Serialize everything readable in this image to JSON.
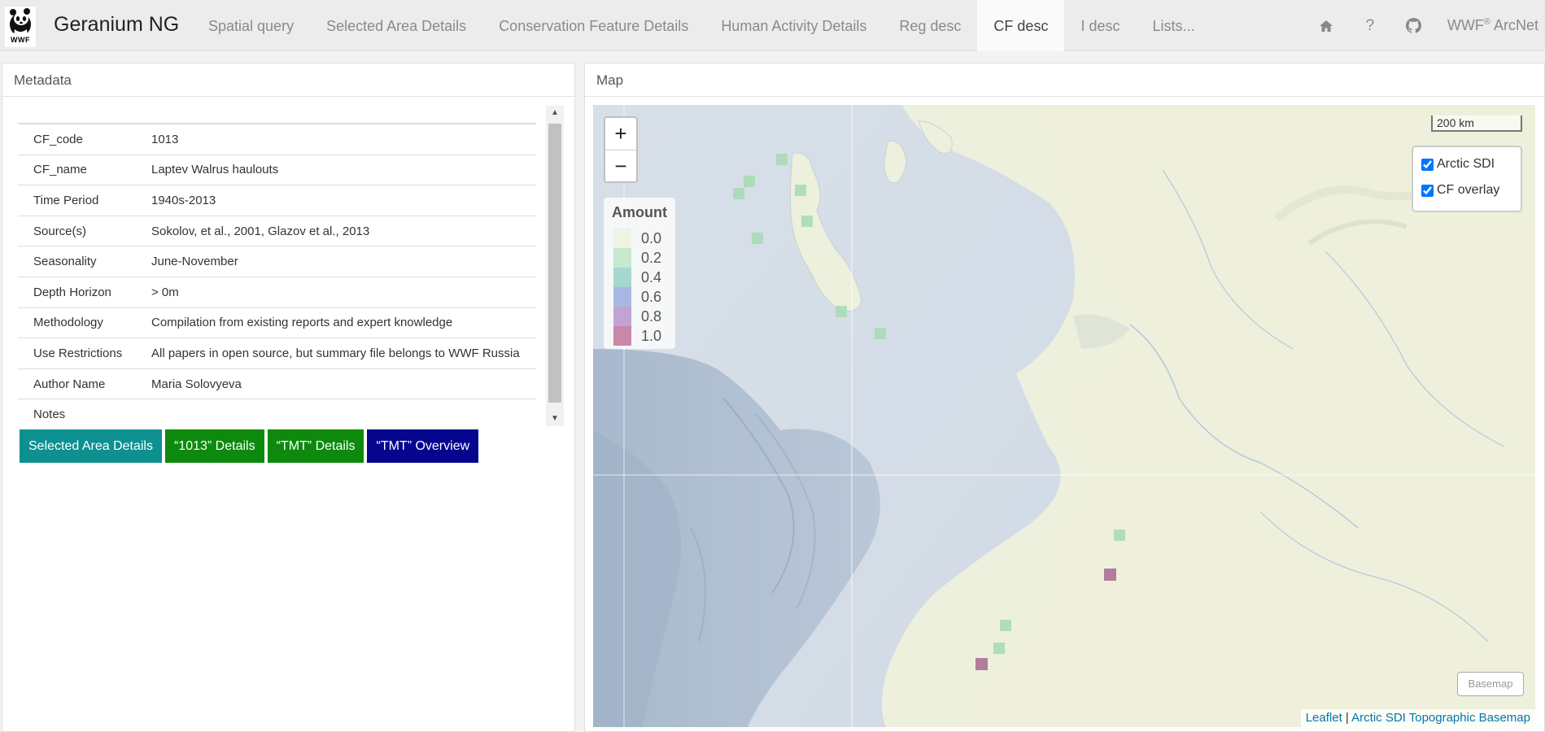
{
  "brand": {
    "name": "Geranium NG",
    "logo_text": "WWF"
  },
  "nav": {
    "tabs": [
      {
        "label": "Spatial query"
      },
      {
        "label": "Selected Area Details"
      },
      {
        "label": "Conservation Feature Details"
      },
      {
        "label": "Human Activity Details"
      },
      {
        "label": "Reg desc"
      },
      {
        "label": "CF desc"
      },
      {
        "label": "I desc"
      },
      {
        "label": "Lists..."
      }
    ],
    "active_tab": "CF desc",
    "icons": [
      "home-icon",
      "help-icon",
      "github-icon"
    ],
    "help_glyph": "?",
    "arcnet_label": "WWF",
    "arcnet_sup": "®",
    "arcnet_suffix": " ArcNet"
  },
  "metadata": {
    "heading": "Metadata",
    "rows": [
      {
        "key": "CF_code",
        "value": "1013"
      },
      {
        "key": "CF_name",
        "value": "Laptev Walrus haulouts"
      },
      {
        "key": "Time Period",
        "value": "1940s-2013"
      },
      {
        "key": "Source(s)",
        "value": "Sokolov, et al., 2001, Glazov et al., 2013"
      },
      {
        "key": "Seasonality",
        "value": "June-November"
      },
      {
        "key": "Depth Horizon",
        "value": "> 0m"
      },
      {
        "key": "Methodology",
        "value": "Compilation from existing reports and expert knowledge"
      },
      {
        "key": "Use Restrictions",
        "value": "All papers in open source, but summary file belongs to WWF Russia"
      },
      {
        "key": "Author Name",
        "value": "Maria Solovyeva"
      },
      {
        "key": "Notes",
        "value": ""
      }
    ],
    "buttons": [
      {
        "label": "Selected Area Details",
        "style": "teal"
      },
      {
        "label": "“1013” Details",
        "style": "green"
      },
      {
        "label": "“TMT” Details",
        "style": "green"
      },
      {
        "label": "“TMT” Overview",
        "style": "navy"
      }
    ]
  },
  "map": {
    "heading": "Map",
    "zoom_in": "+",
    "zoom_out": "−",
    "legend": {
      "title": "Amount",
      "items": [
        {
          "label": "0.0",
          "color": "#eef3e2"
        },
        {
          "label": "0.2",
          "color": "#c6e8cf"
        },
        {
          "label": "0.4",
          "color": "#a6d8cf"
        },
        {
          "label": "0.6",
          "color": "#a8b8e2"
        },
        {
          "label": "0.8",
          "color": "#c2a4d4"
        },
        {
          "label": "1.0",
          "color": "#c888a8"
        }
      ]
    },
    "scale": "200 km",
    "layers": [
      {
        "label": "Arctic SDI",
        "checked": true
      },
      {
        "label": "CF overlay",
        "checked": true
      }
    ],
    "basemap_button": "Basemap",
    "attribution": {
      "leaflet": "Leaflet",
      "separator": " | ",
      "basemap": "Arctic SDI Topographic Basemap"
    }
  }
}
